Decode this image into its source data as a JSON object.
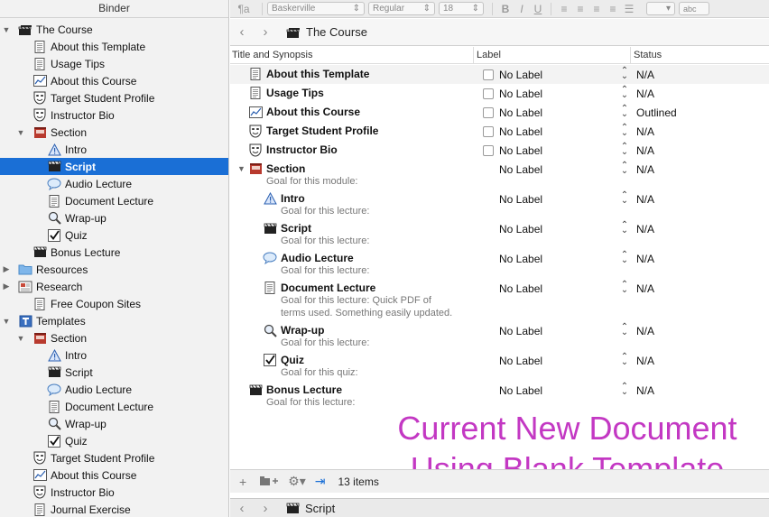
{
  "binder": {
    "title": "Binder",
    "items": [
      {
        "label": "The Course",
        "icon": "clapper-stack-icon",
        "triangle": "down"
      },
      {
        "label": "About this Template",
        "icon": "document-icon"
      },
      {
        "label": "Usage Tips",
        "icon": "document-icon"
      },
      {
        "label": "About this Course",
        "icon": "chart-icon"
      },
      {
        "label": "Target Student Profile",
        "icon": "theater-mask-icon"
      },
      {
        "label": "Instructor Bio",
        "icon": "theater-mask-icon"
      },
      {
        "label": "Section",
        "icon": "section-icon",
        "triangle": "down"
      },
      {
        "label": "Intro",
        "icon": "warning-triangle-icon"
      },
      {
        "label": "Script",
        "icon": "clapperboard-icon",
        "selected": true
      },
      {
        "label": "Audio Lecture",
        "icon": "speech-bubble-icon"
      },
      {
        "label": "Document Lecture",
        "icon": "document-icon"
      },
      {
        "label": "Wrap-up",
        "icon": "magnifier-icon"
      },
      {
        "label": "Quiz",
        "icon": "checkmark-icon"
      },
      {
        "label": "Bonus Lecture",
        "icon": "clapperboard-icon"
      },
      {
        "label": "Resources",
        "icon": "folder-icon",
        "triangle": "right"
      },
      {
        "label": "Research",
        "icon": "research-icon",
        "triangle": "right"
      },
      {
        "label": "Free Coupon Sites",
        "icon": "document-icon"
      },
      {
        "label": "Templates",
        "icon": "templates-icon",
        "triangle": "down"
      },
      {
        "label": "Section",
        "icon": "section-icon",
        "triangle": "down"
      },
      {
        "label": "Intro",
        "icon": "warning-triangle-icon"
      },
      {
        "label": "Script",
        "icon": "clapperboard-icon"
      },
      {
        "label": "Audio Lecture",
        "icon": "speech-bubble-icon"
      },
      {
        "label": "Document Lecture",
        "icon": "document-icon"
      },
      {
        "label": "Wrap-up",
        "icon": "magnifier-icon"
      },
      {
        "label": "Quiz",
        "icon": "checkmark-icon"
      },
      {
        "label": "Target Student Profile",
        "icon": "theater-mask-icon"
      },
      {
        "label": "About this Course",
        "icon": "chart-icon"
      },
      {
        "label": "Instructor Bio",
        "icon": "theater-mask-icon"
      },
      {
        "label": "Journal Exercise",
        "icon": "document-icon"
      }
    ]
  },
  "formatbar": {
    "style_icon": "¶a",
    "font": "Baskerville",
    "weight": "Regular",
    "size": "18",
    "bold": "B",
    "italic": "I",
    "underline": "U",
    "highlight_label": "abc"
  },
  "navbar": {
    "title": "The Course",
    "back_icon": "‹",
    "forward_icon": "›"
  },
  "columns": {
    "title": "Title and Synopsis",
    "label": "Label",
    "status": "Status"
  },
  "outline": {
    "rows": [
      {
        "title": "About this Template",
        "icon": "document-icon",
        "checkbox": true,
        "label": "No Label",
        "status": "N/A"
      },
      {
        "title": "Usage Tips",
        "icon": "document-icon",
        "checkbox": true,
        "label": "No Label",
        "status": "N/A"
      },
      {
        "title": "About this Course",
        "icon": "chart-icon",
        "checkbox": true,
        "label": "No Label",
        "status": "Outlined"
      },
      {
        "title": "Target Student Profile",
        "icon": "theater-mask-icon",
        "checkbox": true,
        "label": "No Label",
        "status": "N/A"
      },
      {
        "title": "Instructor Bio",
        "icon": "theater-mask-icon",
        "checkbox": true,
        "label": "No Label",
        "status": "N/A"
      },
      {
        "title": "Section",
        "icon": "section-icon",
        "label": "No Label",
        "status": "N/A",
        "synopsis": "Goal for this module:",
        "triangle": true
      },
      {
        "title": "Intro",
        "icon": "warning-triangle-icon",
        "label": "No Label",
        "status": "N/A",
        "synopsis": "Goal for this lecture:"
      },
      {
        "title": "Script",
        "icon": "clapperboard-icon",
        "label": "No Label",
        "status": "N/A",
        "synopsis": "Goal for this lecture:"
      },
      {
        "title": "Audio Lecture",
        "icon": "speech-bubble-icon",
        "label": "No Label",
        "status": "N/A",
        "synopsis": "Goal for this lecture:"
      },
      {
        "title": "Document Lecture",
        "icon": "document-icon",
        "label": "No Label",
        "status": "N/A",
        "synopsis": "Goal for this lecture: Quick PDF of",
        "synopsis2": "terms used.  Something easily updated."
      },
      {
        "title": "Wrap-up",
        "icon": "magnifier-icon",
        "label": "No Label",
        "status": "N/A",
        "synopsis": "Goal for this lecture:"
      },
      {
        "title": "Quiz",
        "icon": "checkmark-icon",
        "label": "No Label",
        "status": "N/A",
        "synopsis": "Goal for this quiz:"
      },
      {
        "title": "Bonus Lecture",
        "icon": "clapperboard-icon",
        "label": "No Label",
        "status": "N/A",
        "synopsis": "Goal for this lecture:"
      }
    ]
  },
  "overlay": {
    "line1": "Current New Document",
    "line2": "Using Blank Template"
  },
  "footer": {
    "add_icon": "+",
    "items_count": "13 items"
  },
  "navbar2": {
    "title": "Script",
    "back_icon": "‹",
    "forward_icon": "›"
  },
  "colors": {
    "selection": "#1a6fd6",
    "overlay_text": "#c338c3"
  }
}
